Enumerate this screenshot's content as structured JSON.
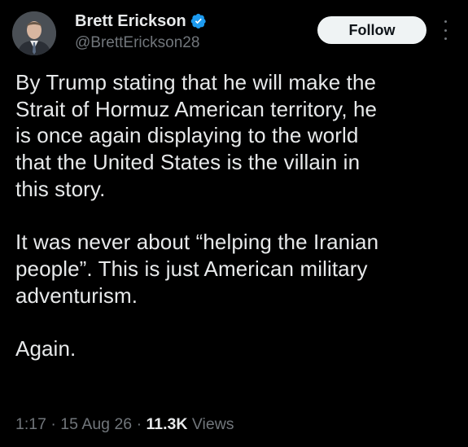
{
  "author": {
    "display_name": "Brett Erickson",
    "handle": "@BrettErickson28",
    "verified_icon": "verified-badge-icon",
    "avatar_icon": "avatar-photo"
  },
  "actions": {
    "follow_label": "Follow",
    "more_icon": "more-options-icon"
  },
  "post": {
    "paragraphs": [
      "By Trump stating that he will make the\nStrait of Hormuz American territory, he\nis once again displaying to the world\nthat the United States is the villain in\nthis story.",
      "It was never about “helping the Iranian\npeople”. This is just American military\nadventurism.",
      "Again."
    ]
  },
  "meta": {
    "time": "1:17",
    "date": "15 Aug 26",
    "separator": "·",
    "views_count": "11.3K",
    "views_label": "Views"
  },
  "colors": {
    "background": "#000000",
    "text_primary": "#e7e9ea",
    "text_secondary": "#71767b",
    "verified_blue": "#1d9bf0",
    "follow_bg": "#eff3f4"
  }
}
